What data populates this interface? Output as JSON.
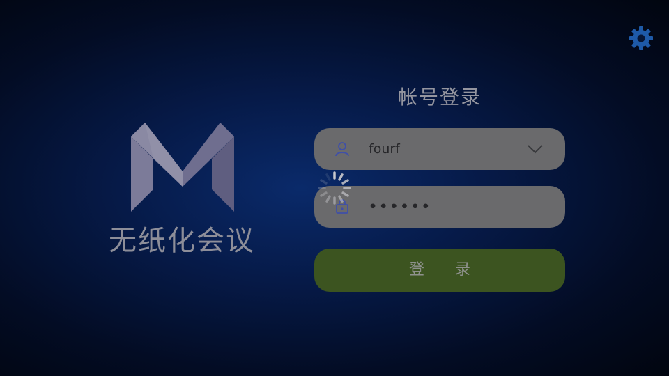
{
  "app": {
    "name": "无纸化会议"
  },
  "login": {
    "title": "帐号登录",
    "username_value": "fourf",
    "password_value": "••••••",
    "submit_label": "登　　录"
  },
  "icons": {
    "settings": "gear-icon",
    "user": "user-icon",
    "lock": "lock-icon",
    "dropdown": "chevron-down-icon",
    "spinner": "loading-spinner-icon"
  },
  "colors": {
    "accent_icon": "#1e5aa8",
    "login_button": "#3c5420",
    "field_background": "#6a6a6c"
  }
}
